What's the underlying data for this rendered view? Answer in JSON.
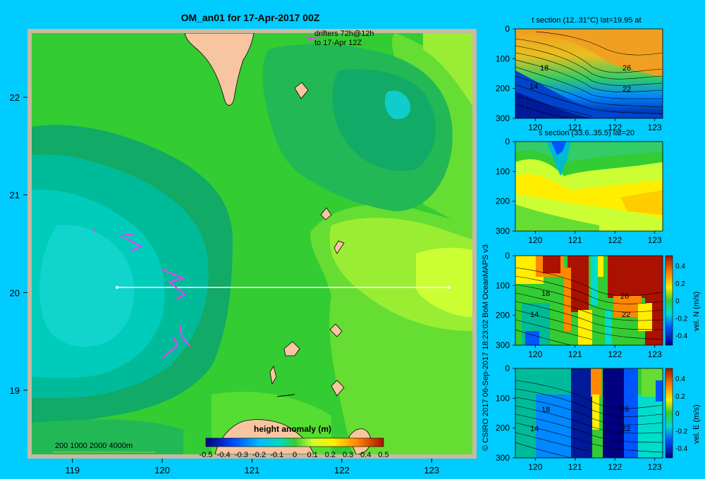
{
  "map": {
    "title": "OM_an01 for 17-Apr-2017 00Z",
    "drifter_note_line1": "drifters 72h@12h",
    "drifter_note_line2": "to 17-Apr 12Z",
    "depth_legend": "200  1000  2000  4000m",
    "colorbar_title": "height anomaly (m)",
    "colorbar_ticks": [
      "-0.5",
      "-0.4",
      "-0.3",
      "-0.2",
      "-0.1",
      "0",
      "0.1",
      "0.2",
      "0.3",
      "0.4",
      "0.5"
    ],
    "x_ticks": [
      "119",
      "120",
      "121",
      "122",
      "123"
    ],
    "y_ticks": [
      "22",
      "21",
      "20",
      "19"
    ],
    "colors": {
      "frame": "#c8b9a0",
      "land": "#f7c6a0",
      "sea_green": "#33cc33",
      "drifter": "#ff33ff",
      "section_line": "#ffffff"
    }
  },
  "credit": "© CSIRO 2017   06-Sep-2017 18:23:02 BoM OceanMAPS v3",
  "panels": [
    {
      "title": "t section (12..31°C) lat=19.95 at",
      "y_ticks": [
        "0",
        "100",
        "200",
        "300"
      ],
      "x_ticks": [
        "120",
        "121",
        "122",
        "123"
      ],
      "contour_labels": [
        "18",
        "14",
        "26",
        "22"
      ],
      "colorbar": null
    },
    {
      "title": "s section (33.6..35.5) lat=20",
      "y_ticks": [
        "0",
        "100",
        "200",
        "300"
      ],
      "x_ticks": [
        "120",
        "121",
        "122",
        "123"
      ],
      "contour_labels": [],
      "colorbar": null
    },
    {
      "title": "",
      "y_ticks": [
        "0",
        "100",
        "200",
        "300"
      ],
      "x_ticks": [
        "120",
        "121",
        "122",
        "123"
      ],
      "contour_labels": [
        "18",
        "14",
        "26",
        "22"
      ],
      "colorbar": {
        "label": "vel. N  (m/s)",
        "ticks": [
          "0.4",
          "0.2",
          "0",
          "-0.2",
          "-0.4"
        ]
      }
    },
    {
      "title": "",
      "y_ticks": [
        "0",
        "100",
        "200",
        "300"
      ],
      "x_ticks": [
        "120",
        "121",
        "122",
        "123"
      ],
      "contour_labels": [
        "18",
        "14",
        "26",
        "22"
      ],
      "colorbar": {
        "label": "vel. E  (m/s)",
        "ticks": [
          "0.4",
          "0.2",
          "0",
          "-0.2",
          "-0.4"
        ]
      }
    }
  ],
  "chart_data": [
    {
      "type": "heatmap",
      "title": "OM_an01 for 17-Apr-2017 00Z",
      "xlabel": "",
      "ylabel": "",
      "xlim": [
        118.5,
        123.5
      ],
      "ylim": [
        18.3,
        22.7
      ],
      "x_ticks": [
        119,
        120,
        121,
        122,
        123
      ],
      "y_ticks": [
        19,
        20,
        21,
        22
      ],
      "colorbar": {
        "label": "height anomaly (m)",
        "range": [
          -0.5,
          0.5
        ]
      },
      "section_line": {
        "lat": 20,
        "lon_range": [
          119.5,
          123.2
        ]
      }
    },
    {
      "type": "heatmap",
      "title": "t section (12..31°C) lat=19.95 at",
      "xlim": [
        119.5,
        123.2
      ],
      "ylim": [
        300,
        0
      ],
      "x_ticks": [
        120,
        121,
        122,
        123
      ],
      "y_ticks": [
        0,
        100,
        200,
        300
      ],
      "contour_labels": [
        18,
        14,
        26,
        22
      ]
    },
    {
      "type": "heatmap",
      "title": "s section (33.6..35.5) lat=20",
      "xlim": [
        119.5,
        123.2
      ],
      "ylim": [
        300,
        0
      ],
      "x_ticks": [
        120,
        121,
        122,
        123
      ],
      "y_ticks": [
        0,
        100,
        200,
        300
      ]
    },
    {
      "type": "heatmap",
      "title": "",
      "colorbar": {
        "label": "vel. N  (m/s)",
        "range": [
          -0.4,
          0.4
        ]
      },
      "xlim": [
        119.5,
        123.2
      ],
      "ylim": [
        300,
        0
      ],
      "x_ticks": [
        120,
        121,
        122,
        123
      ],
      "y_ticks": [
        0,
        100,
        200,
        300
      ]
    },
    {
      "type": "heatmap",
      "title": "",
      "colorbar": {
        "label": "vel. E  (m/s)",
        "range": [
          -0.4,
          0.4
        ]
      },
      "xlim": [
        119.5,
        123.2
      ],
      "ylim": [
        300,
        0
      ],
      "x_ticks": [
        120,
        121,
        122,
        123
      ],
      "y_ticks": [
        0,
        100,
        200,
        300
      ]
    }
  ]
}
